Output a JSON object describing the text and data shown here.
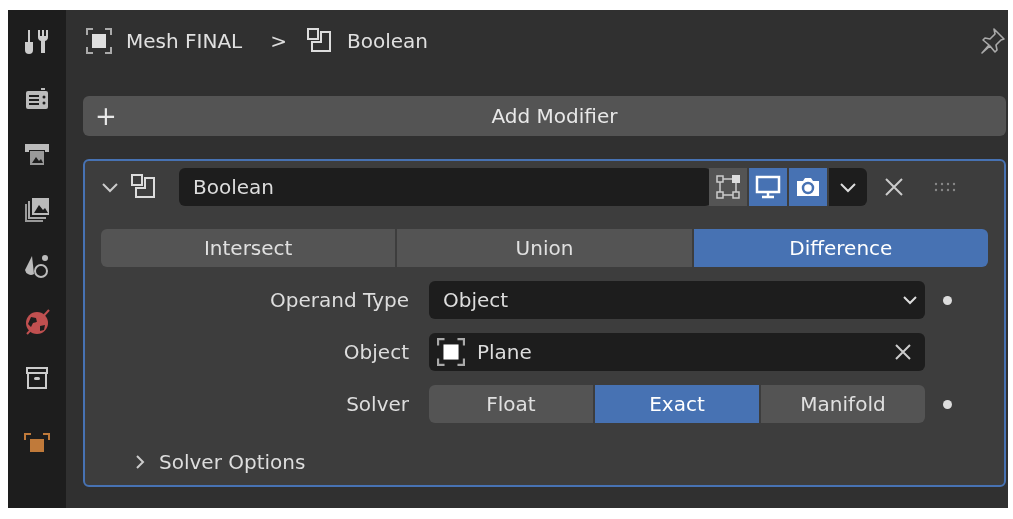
{
  "sidebar": {
    "tabs": [
      {
        "kind": "tool",
        "selected": false
      },
      {
        "kind": "render",
        "selected": false
      },
      {
        "kind": "output",
        "selected": false
      },
      {
        "kind": "view_layer",
        "selected": false
      },
      {
        "kind": "scene",
        "selected": false
      },
      {
        "kind": "world",
        "selected": false
      },
      {
        "kind": "collection",
        "selected": false
      },
      {
        "kind": "object",
        "selected": false
      }
    ]
  },
  "breadcrumb": {
    "object": "Mesh FINAL",
    "separator": ">",
    "modifier": "Boolean"
  },
  "add_modifier": {
    "icon": "+",
    "label": "Add Modifier"
  },
  "modifier": {
    "expanded": true,
    "name": "Boolean",
    "toggles": [
      {
        "kind": "edit_mode",
        "on": false
      },
      {
        "kind": "viewport",
        "on": true
      },
      {
        "kind": "render",
        "on": true
      }
    ],
    "operations": [
      {
        "label": "Intersect",
        "selected": false
      },
      {
        "label": "Union",
        "selected": false
      },
      {
        "label": "Difference",
        "selected": true
      }
    ],
    "rows": [
      {
        "kind": "dropdown",
        "label": "Operand Type",
        "value": "Object",
        "keyframe_dot": true
      },
      {
        "kind": "object",
        "label": "Object",
        "value": "Plane",
        "keyframe_dot": false
      },
      {
        "kind": "segmented",
        "label": "Solver",
        "options": [
          {
            "label": "Float",
            "selected": false
          },
          {
            "label": "Exact",
            "selected": true
          },
          {
            "label": "Manifold",
            "selected": false
          }
        ],
        "keyframe_dot": true
      }
    ],
    "subpanel": {
      "label": "Solver Options",
      "expanded": false
    }
  }
}
